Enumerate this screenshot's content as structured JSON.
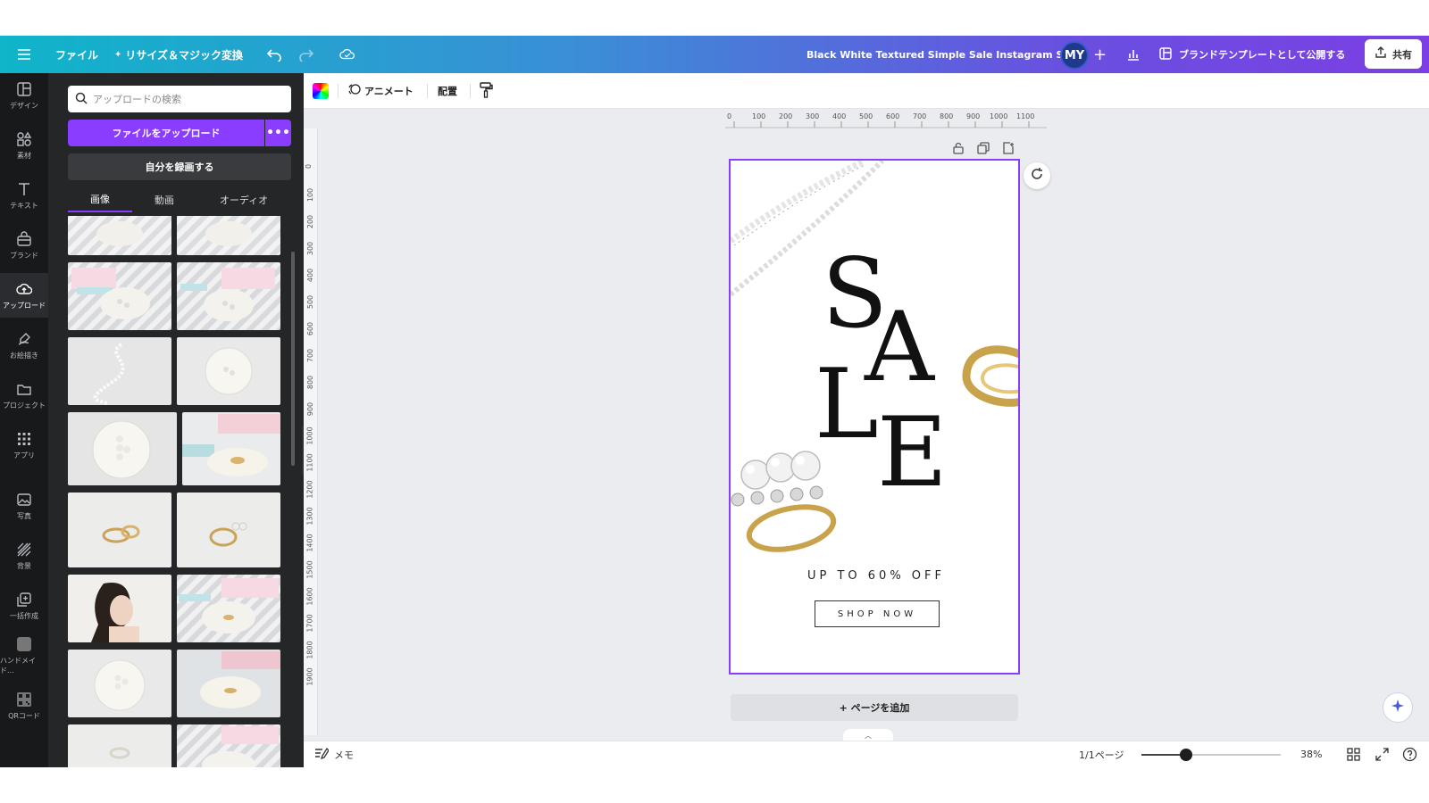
{
  "topbar": {
    "file": "ファイル",
    "resize": "リサイズ＆マジック変換",
    "doc_title": "Black White Textured Simple Sale Instagram Story",
    "avatar": "MY",
    "add_member": "+",
    "publish_brand": "ブランドテンプレートとして公開する",
    "share": "共有"
  },
  "rail": {
    "items": [
      {
        "label": "デザイン",
        "icon": "layout-icon"
      },
      {
        "label": "素材",
        "icon": "shapes-icon"
      },
      {
        "label": "テキスト",
        "icon": "text-icon"
      },
      {
        "label": "ブランド",
        "icon": "brand-icon"
      },
      {
        "label": "アップロード",
        "icon": "cloud-upload-icon"
      },
      {
        "label": "お絵描き",
        "icon": "draw-icon"
      },
      {
        "label": "プロジェクト",
        "icon": "folder-icon"
      },
      {
        "label": "アプリ",
        "icon": "apps-icon"
      },
      {
        "label": "写真",
        "icon": "photo-icon"
      },
      {
        "label": "背景",
        "icon": "background-icon"
      },
      {
        "label": "一括作成",
        "icon": "bulk-create-icon"
      },
      {
        "label": "ハンドメイド...",
        "icon": "handmade-app-icon"
      },
      {
        "label": "QRコード",
        "icon": "qr-code-icon"
      }
    ],
    "active_index": 4
  },
  "panel": {
    "search_placeholder": "アップロードの検索",
    "upload_label": "ファイルをアップロード",
    "more": "•••",
    "record_label": "自分を録画する",
    "tabs": [
      "画像",
      "動画",
      "オーディオ"
    ],
    "active_tab": 0
  },
  "editbar": {
    "animate": "アニメート",
    "arrange": "配置"
  },
  "rulers": {
    "h": [
      "0",
      "100",
      "200",
      "300",
      "400",
      "500",
      "600",
      "700",
      "800",
      "900",
      "1000",
      "1100"
    ],
    "v": [
      "0",
      "100",
      "200",
      "300",
      "400",
      "500",
      "600",
      "700",
      "800",
      "900",
      "1000",
      "1100",
      "1200",
      "1300",
      "1400",
      "1500",
      "1600",
      "1700",
      "1800",
      "1900"
    ]
  },
  "design": {
    "letters": [
      "S",
      "A",
      "L",
      "E"
    ],
    "offer": "UP TO 60% OFF",
    "cta": "SHOP NOW"
  },
  "add_page": "+ ページを追加",
  "footer": {
    "notes": "メモ",
    "pages": "1/1ページ",
    "zoom_label": "38%",
    "zoom_fraction": 0.32
  },
  "colors": {
    "accent": "#8b3dff"
  }
}
